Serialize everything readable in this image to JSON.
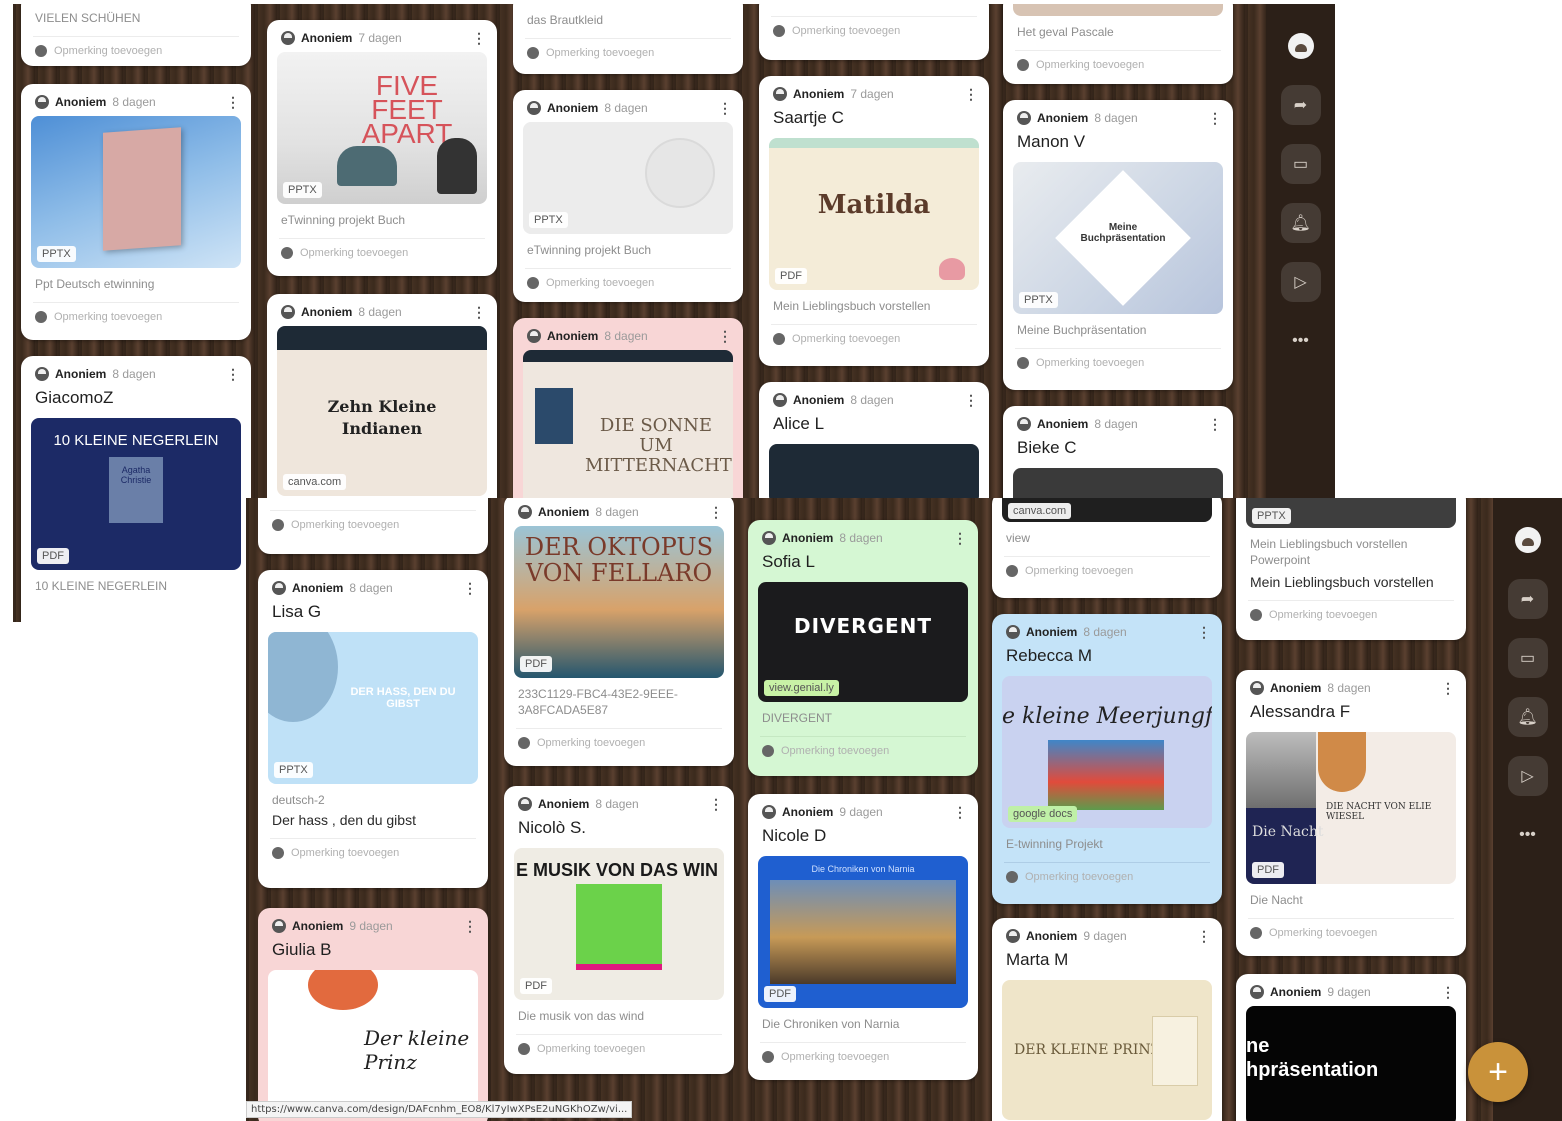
{
  "common": {
    "author": "Anoniem",
    "comment_placeholder": "Opmerking toevoegen"
  },
  "shot1": {
    "columns": [
      [
        {
          "caption": "VIELEN SCHÜHEN"
        },
        {
          "ago": "8 dagen",
          "badge": "PPTX",
          "caption": "Ppt Deutsch etwinning"
        },
        {
          "ago": "8 dagen",
          "title": "GiacomoZ",
          "thumb_text": "10 KLEINE NEGERLEIN",
          "thumb_sub": "Agatha Christie",
          "badge": "PDF",
          "caption": "10 KLEINE NEGERLEIN"
        }
      ],
      [
        {
          "ago": "7 dagen",
          "thumb_text": "FIVE FEET APART",
          "badge": "PPTX",
          "caption": "eTwinning projekt Buch"
        },
        {
          "ago": "8 dagen",
          "thumb_text": "Zehn Kleine Indianen",
          "badge": "canva.com"
        }
      ],
      [
        {
          "caption": "das Brautkleid"
        },
        {
          "ago": "8 dagen",
          "badge": "PPTX",
          "caption": "eTwinning projekt Buch"
        },
        {
          "ago": "8 dagen",
          "thumb_text": "DIE SONNE UM MITTERNACHT"
        }
      ],
      [
        {
          "ago": "7 dagen",
          "title": "Saartje C",
          "thumb_text": "Matilda",
          "badge": "PDF",
          "caption": "Mein Lieblingsbuch vorstellen"
        },
        {
          "ago": "8 dagen",
          "title": "Alice L"
        }
      ],
      [
        {
          "caption": "Het geval Pascale"
        },
        {
          "ago": "8 dagen",
          "title": "Manon V",
          "thumb_text": "Meine Buchpräsentation",
          "badge": "PPTX",
          "caption": "Meine Buchpräsentation"
        },
        {
          "ago": "8 dagen",
          "title": "Bieke C"
        }
      ]
    ]
  },
  "shot2": {
    "columns": [
      [
        {
          "ago": "8 dagen",
          "title": "Lisa G",
          "thumb_text": "DER HASS, DEN DU GIBST",
          "badge": "PPTX",
          "caption": "deutsch-2",
          "caption2": "Der hass , den du gibst"
        },
        {
          "ago": "9 dagen",
          "title": "Giulia B",
          "thumb_text": "Der kleine Prinz"
        }
      ],
      [
        {
          "ago": "8 dagen",
          "thumb_text": "DER OKTOPUS VON FELLARO",
          "badge": "PDF",
          "caption": "233C1129-FBC4-43E2-9EEE-3A8FCADA5E87"
        },
        {
          "ago": "8 dagen",
          "title": "Nicolò S.",
          "thumb_text": "E MUSIK VON DAS WIN",
          "badge": "PDF",
          "caption": "Die musik von das wind"
        }
      ],
      [
        {
          "ago": "8 dagen",
          "title": "Sofia L",
          "thumb_text": "DIVERGENT",
          "badge": "view.genial.ly",
          "caption": "DIVERGENT"
        },
        {
          "ago": "9 dagen",
          "title": "Nicole D",
          "thumb_text": "Die Chroniken von Narnia",
          "badge": "PDF",
          "caption": "Die Chroniken von Narnia"
        }
      ],
      [
        {
          "badge": "canva.com",
          "caption": "view"
        },
        {
          "ago": "8 dagen",
          "title": "Rebecca M",
          "thumb_text": "e kleine Meerjungfrau",
          "badge": "google docs",
          "caption": "E-twinning Projekt"
        },
        {
          "ago": "9 dagen",
          "title": "Marta M",
          "thumb_text": "DER KLEINE PRINZ"
        }
      ],
      [
        {
          "badge": "PPTX",
          "caption": "Mein Lieblingsbuch vorstellen Powerpoint",
          "caption2": "Mein Lieblingsbuch vorstellen"
        },
        {
          "ago": "8 dagen",
          "title": "Alessandra F",
          "thumb_text": "DIE NACHT VON ELIE WIESEL",
          "thumb_sub": "Die Nacht",
          "badge": "PDF",
          "caption": "Die Nacht"
        },
        {
          "ago": "9 dagen",
          "thumb_text": "ne hpräsentation"
        }
      ]
    ]
  },
  "rail": {
    "icons": [
      "avatar-icon",
      "share-icon",
      "slideshow-icon",
      "bell-icon",
      "play-icon",
      "more-icon"
    ],
    "more_label": "•••"
  },
  "fab_label": "+",
  "status_url": "https://www.canva.com/design/DAFcnhm_EO8/Kl7yIwXPsE2uNGKhOZw/vi..."
}
